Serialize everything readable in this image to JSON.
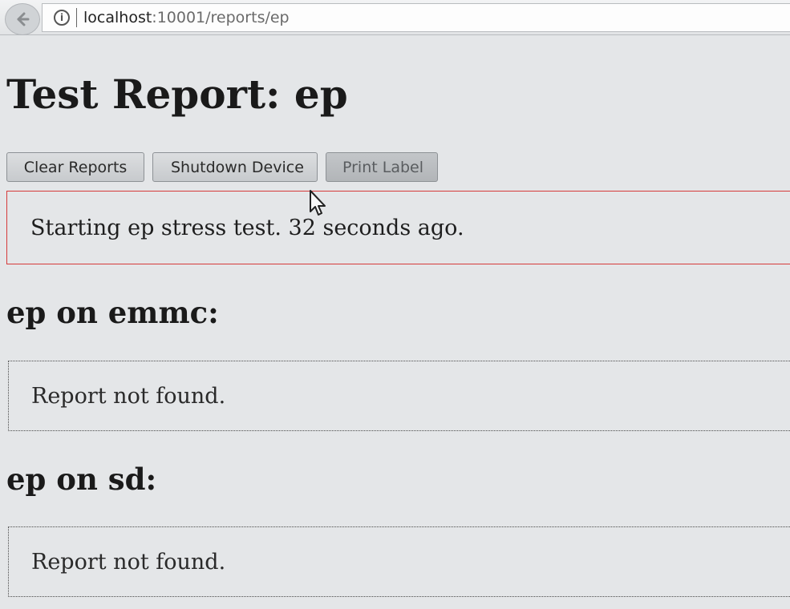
{
  "browser": {
    "url_host": "localhost",
    "url_rest": ":10001/reports/ep",
    "icons": [
      "back-arrow-icon",
      "info-icon"
    ]
  },
  "page": {
    "title": "Test Report: ep"
  },
  "toolbar": {
    "clear_label": "Clear Reports",
    "shutdown_label": "Shutdown Device",
    "print_label": "Print Label"
  },
  "status": {
    "message": "Starting ep stress test. 32 seconds ago.",
    "border_color": "#d63a3a"
  },
  "sections": [
    {
      "heading": "ep on emmc:",
      "report": "Report not found."
    },
    {
      "heading": "ep on sd:",
      "report": "Report not found."
    }
  ]
}
